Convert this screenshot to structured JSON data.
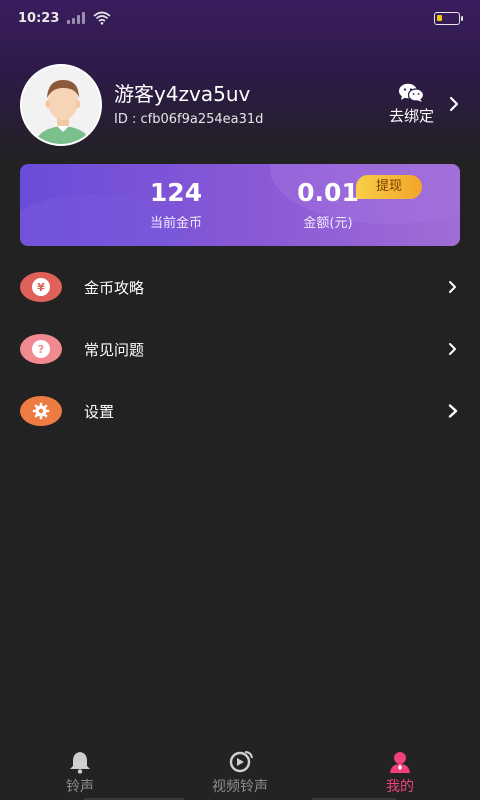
{
  "status_bar": {
    "time": "10:23"
  },
  "profile": {
    "username": "游客y4zva5uv",
    "user_id": "ID : cfb06f9a254ea31d",
    "bind_label": "去绑定",
    "bind_icon": "wechat-icon"
  },
  "coin_card": {
    "coins_value": "124",
    "coins_label": "当前金币",
    "money_value": "0.01",
    "money_label": "金额(元)",
    "withdraw_label": "提现"
  },
  "menu": {
    "items": [
      {
        "label": "金币攻略",
        "icon": "yen-icon",
        "color": "#e0605a"
      },
      {
        "label": "常见问题",
        "icon": "question-icon",
        "color": "#f08a90"
      },
      {
        "label": "设置",
        "icon": "gear-icon",
        "color": "#ee7c42"
      }
    ]
  },
  "tabbar": {
    "tabs": [
      {
        "label": "铃声",
        "icon": "bell-icon",
        "active": false
      },
      {
        "label": "视频铃声",
        "icon": "video-icon",
        "active": false
      },
      {
        "label": "我的",
        "icon": "person-icon",
        "active": true
      }
    ]
  }
}
